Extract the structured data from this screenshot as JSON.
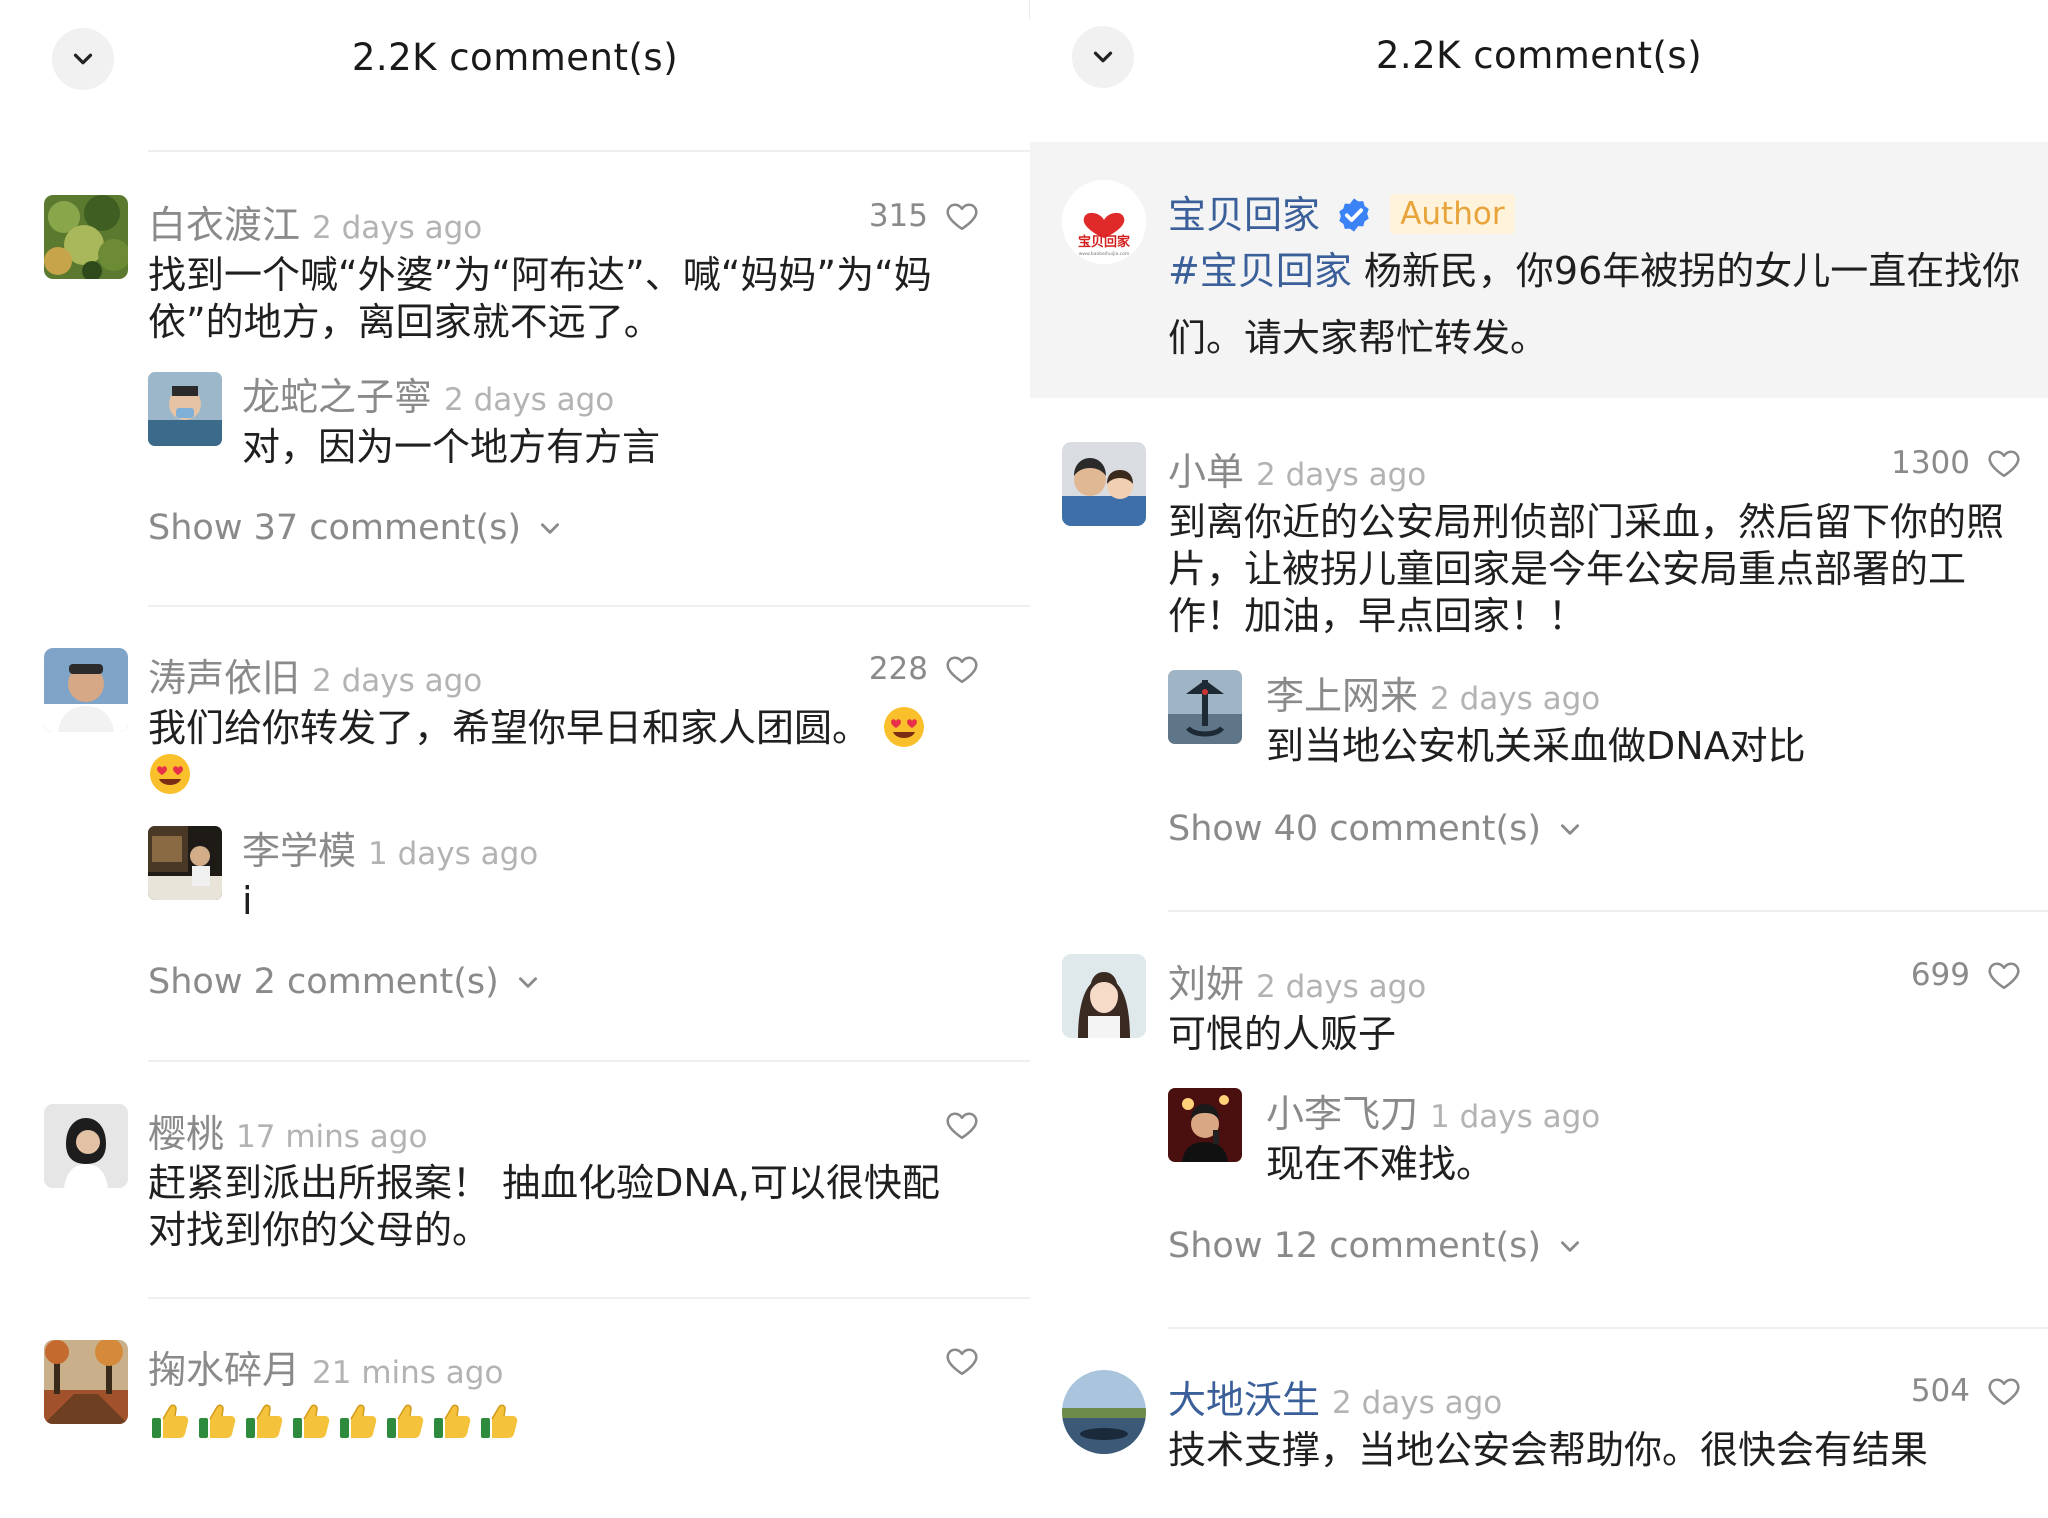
{
  "left": {
    "title": "2.2K comment(s)",
    "comments": [
      {
        "user": "白衣渡江",
        "time": "2 days ago",
        "likes": "315",
        "text": "找到一个喊“外婆”为“阿布达”、喊“妈妈”为“妈依”的地方，离回家就不远了。",
        "reply": {
          "user": "龙蛇之子寧",
          "time": "2 days ago",
          "text": "对，因为一个地方有方言"
        },
        "show_more": "Show 37 comment(s)"
      },
      {
        "user": "涛声依旧",
        "time": "2 days ago",
        "likes": "228",
        "text": "我们给你转发了，希望你早日和家人团圆。",
        "reply": {
          "user": "李学模",
          "time": "1 days ago",
          "text": "i"
        },
        "show_more": "Show 2 comment(s)"
      },
      {
        "user": "樱桃",
        "time": "17 mins ago",
        "likes": "",
        "text": "赶紧到派出所报案！ 抽血化验DNA,可以很快配对找到你的父母的。"
      },
      {
        "user": "掬水碎月",
        "time": "21 mins ago",
        "likes": ""
      }
    ]
  },
  "right": {
    "title": "2.2K comment(s)",
    "author_post": {
      "user": "宝贝回家",
      "tag": "Author",
      "hashtag": "#宝贝回家",
      "text": " 杨新民，你96年被拐的女儿一直在找你们。请大家帮忙转发。",
      "logo_text": "宝贝回家",
      "logo_url": "www.baobeihuijia.com"
    },
    "comments": [
      {
        "user": "小单",
        "time": "2 days ago",
        "likes": "1300",
        "text": "到离你近的公安局刑侦部门采血，然后留下你的照片，让被拐儿童回家是今年公安局重点部署的工作！加油，早点回家！！",
        "reply": {
          "user": "李上网来",
          "time": "2 days ago",
          "text": "到当地公安机关采血做DNA对比"
        },
        "show_more": "Show 40 comment(s)"
      },
      {
        "user": "刘妍",
        "time": "2 days ago",
        "likes": "699",
        "text": "可恨的人贩子",
        "reply": {
          "user": "小李飞刀",
          "time": "1 days ago",
          "text": "现在不难找。"
        },
        "show_more": "Show 12 comment(s)"
      },
      {
        "user": "大地沃生",
        "time": "2 days ago",
        "likes": "504",
        "text": "技术支撑，当地公安会帮助你。很快会有结果"
      }
    ]
  },
  "colors": {
    "username": "#8a8a8a",
    "author_name": "#3a5f99",
    "author_tag": "#e8a33a",
    "verified": "#3b82f6"
  },
  "icons": [
    "chevron-down-icon",
    "heart-outline-icon",
    "verified-badge-icon",
    "heart-eyes-emoji",
    "thumbs-up-emoji"
  ]
}
